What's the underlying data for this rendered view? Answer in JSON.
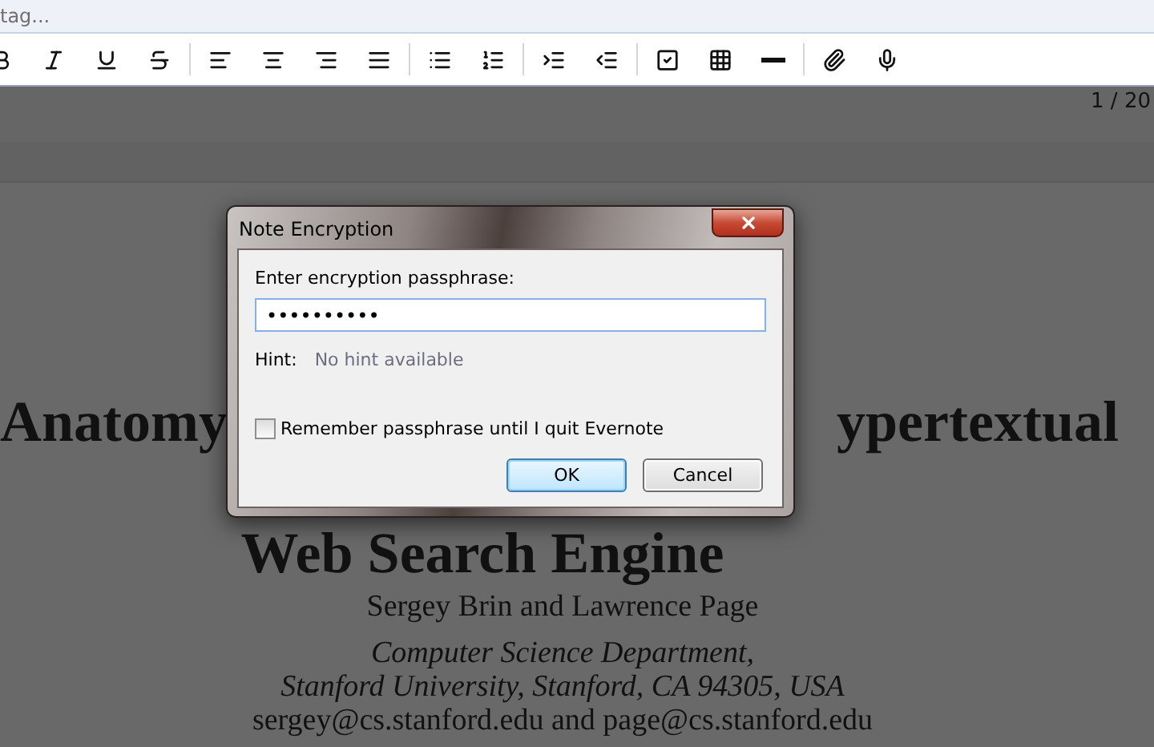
{
  "tag_field": {
    "placeholder": "tag..."
  },
  "page_counter": "1 / 20",
  "document": {
    "title_parts": [
      "Anatomy",
      "ypertextual"
    ],
    "title_line_2": "Web Search Engine",
    "authors": "Sergey Brin and Lawrence Page",
    "affiliation": [
      "Computer Science Department,",
      "Stanford University, Stanford, CA 94305, USA"
    ],
    "emails": "sergey@cs.stanford.edu and page@cs.stanford.edu"
  },
  "dialog": {
    "title": "Note Encryption",
    "passphrase_label": "Enter encryption passphrase:",
    "passphrase_value": "••••••••••",
    "hint_label": "Hint:",
    "hint_text": "No hint available",
    "remember": {
      "label": "Remember passphrase until I quit Evernote",
      "checked": false
    },
    "buttons": [
      {
        "label": "OK",
        "default": true
      },
      {
        "label": "Cancel",
        "default": false
      }
    ]
  }
}
